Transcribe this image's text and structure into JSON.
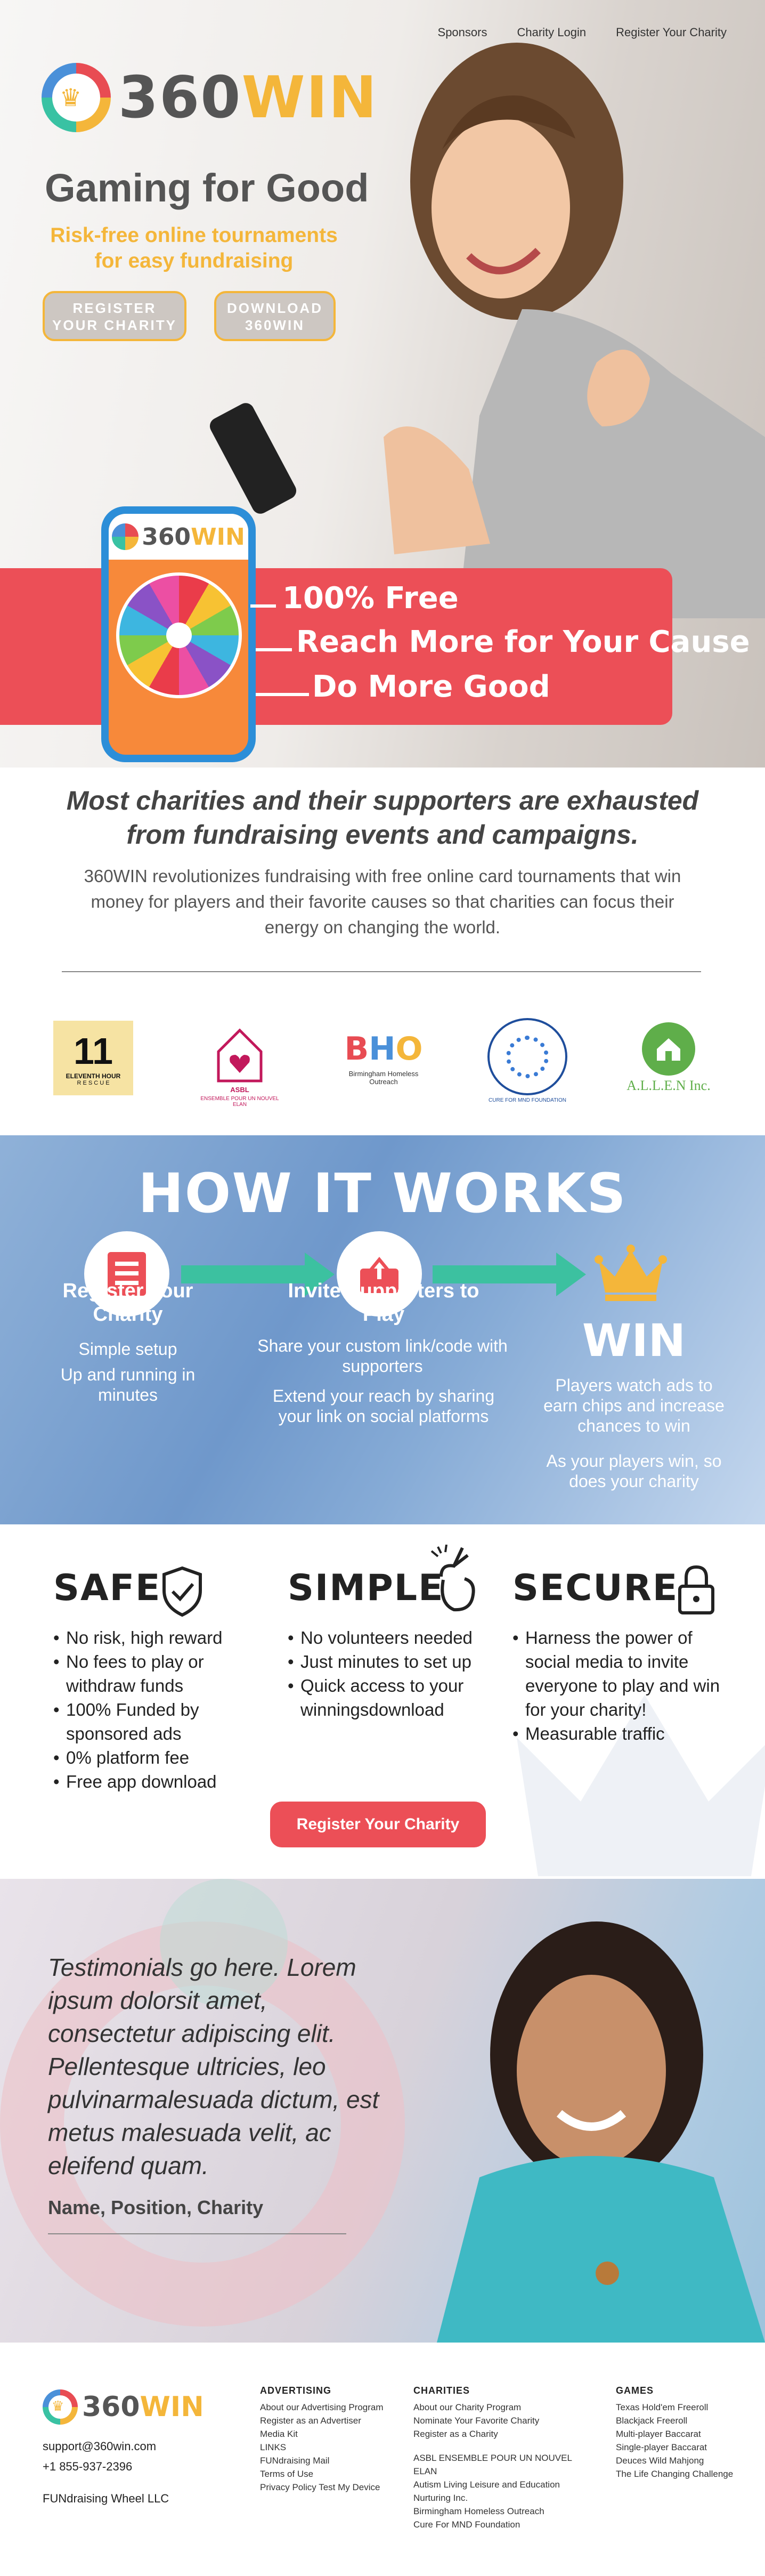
{
  "nav": {
    "items": [
      "Sponsors",
      "Charity Login",
      "Register Your Charity"
    ]
  },
  "brand": {
    "name_part1": "360",
    "name_part2": "WIN",
    "colors": {
      "red": "#ec4f57",
      "gold": "#f4b63a",
      "teal": "#3cc1a0",
      "blue": "#2c8ed8"
    }
  },
  "hero": {
    "title": "Gaming for Good",
    "subtitle": "Risk-free online tournaments for easy fundraising",
    "buttons": {
      "register_line1": "REGISTER",
      "register_line2": "YOUR CHARITY",
      "download_line1": "DOWNLOAD",
      "download_line2": "360WIN"
    },
    "claims": [
      "100% Free",
      "Reach More for Your Cause",
      "Do More Good"
    ]
  },
  "intro": {
    "headline": "Most charities and their supporters are exhausted from fundraising events and campaigns.",
    "body": "360WIN revolutionizes fundraising with free online card tournaments that win money for players and their favorite causes so that charities can focus their energy on changing the world."
  },
  "sponsors": [
    {
      "name": "ELEVENTH HOUR",
      "caption": "R E S C U E"
    },
    {
      "name": "ASBL",
      "caption": "ENSEMBLE POUR UN NOUVEL ELAN"
    },
    {
      "name": "BHO",
      "caption": "Birmingham Homeless Outreach"
    },
    {
      "name": "CURE FOR MND FOUNDATION",
      "caption": ""
    },
    {
      "name": "A.L.L.E.N Inc.",
      "caption": ""
    }
  ],
  "how": {
    "title": "HOW IT WORKS",
    "steps": [
      {
        "title": "Register your Charity",
        "lines": [
          "Simple setup",
          "Up and running in minutes"
        ],
        "icon": "document-icon"
      },
      {
        "title": "Invite Supporters to Play",
        "lines": [
          "Share your custom link/code with supporters",
          "Extend your reach by sharing your link on social platforms"
        ],
        "icon": "share-icon"
      },
      {
        "title": "WIN",
        "lines": [
          "Players watch ads to earn chips and increase chances to win",
          "As your players win, so does your charity"
        ],
        "icon": "crown-icon"
      }
    ]
  },
  "features": {
    "safe": {
      "title": "SAFE",
      "items": [
        "No risk, high reward",
        "No fees to play or withdraw funds",
        "100% Funded by sponsored ads",
        "0% platform fee",
        "Free app download"
      ]
    },
    "simple": {
      "title": "SIMPLE",
      "items": [
        "No volunteers needed",
        "Just minutes to set up",
        "Quick access to your winningsdownload"
      ]
    },
    "secure": {
      "title": "SECURE",
      "items": [
        "Harness the power of social media to invite everyone to play and win for your charity!",
        "Measurable traffic"
      ]
    },
    "cta": "Register Your Charity"
  },
  "testimonial": {
    "quote": "Testimonials go here. Lorem ipsum dolorsit amet, consectetur adipiscing elit. Pellentesque ultricies, leo pulvinarmalesuada dictum, est metus malesuada velit, ac eleifend quam.",
    "name": "Name, Position, Charity"
  },
  "footer": {
    "email": "support@360win.com",
    "phone": "+1 855-937-2396",
    "company": "FUNdraising Wheel LLC",
    "columns": [
      {
        "heading": "ADVERTISING",
        "links": [
          "About our Advertising Program",
          "Register as an Advertiser",
          "Media Kit",
          "LINKS",
          "FUNdraising Mail",
          "Terms of Use",
          "Privacy Policy Test My Device"
        ]
      },
      {
        "heading": "CHARITIES",
        "links": [
          "About our Charity Program",
          "Nominate Your Favorite Charity",
          "Register as a Charity",
          "",
          "ASBL ENSEMBLE POUR UN NOUVEL ELAN",
          "Autism Living Leisure and Education Nurturing Inc.",
          "Birmingham Homeless Outreach",
          "Cure For MND Foundation"
        ]
      },
      {
        "heading": "GAMES",
        "links": [
          "Texas Hold'em Freeroll",
          "Blackjack Freeroll",
          "Multi-player Baccarat",
          "Single-player Baccarat",
          "Deuces Wild Mahjong",
          "The Life Changing  Challenge"
        ]
      }
    ]
  }
}
